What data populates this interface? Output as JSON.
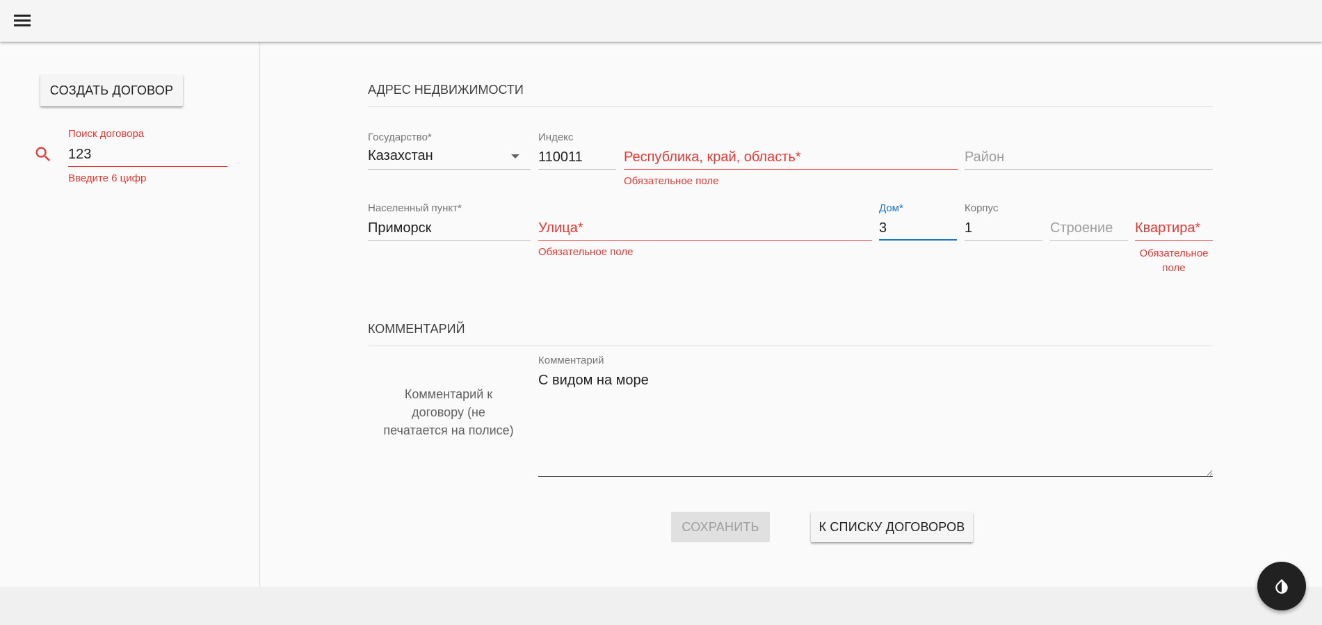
{
  "header": {
    "menu_icon": "hamburger-menu-icon"
  },
  "sidebar": {
    "create_button": "СОЗДАТЬ ДОГОВОР",
    "search": {
      "label": "Поиск договора",
      "value": "123",
      "helper_error": "Введите 6 цифр",
      "icon": "search-icon"
    }
  },
  "address": {
    "section_title": "АДРЕС НЕДВИЖИМОСТИ",
    "country": {
      "label": "Государство*",
      "value": "Казахстан"
    },
    "index": {
      "label": "Индекс",
      "value": "110011"
    },
    "region": {
      "placeholder": "Республика, край, область*",
      "error": "Обязательное поле"
    },
    "district": {
      "placeholder": "Район"
    },
    "locality": {
      "label": "Населенный пункт*",
      "value": "Приморск"
    },
    "street": {
      "placeholder": "Улица*",
      "error": "Обязательное поле"
    },
    "house": {
      "label": "Дом*",
      "value": "3"
    },
    "corpus": {
      "label": "Корпус",
      "value": "1"
    },
    "building": {
      "placeholder": "Строение"
    },
    "apartment": {
      "placeholder": "Квартира*",
      "error_line1": "Обязательное",
      "error_line2": "поле"
    }
  },
  "comment": {
    "section_title": "КОММЕНТАРИЙ",
    "description_line1": "Комментарий к",
    "description_line2": "договору (не",
    "description_line3": "печатается на полисе)",
    "label": "Комментарий",
    "value": "С видом на море"
  },
  "actions": {
    "save": "СОХРАНИТЬ",
    "to_list": "К СПИСКУ ДОГОВОРОВ"
  },
  "colors": {
    "error": "#e53935",
    "focus": "#1976d2",
    "background": "#fafafa"
  },
  "fab": {
    "icon": "invert-colors-icon"
  }
}
